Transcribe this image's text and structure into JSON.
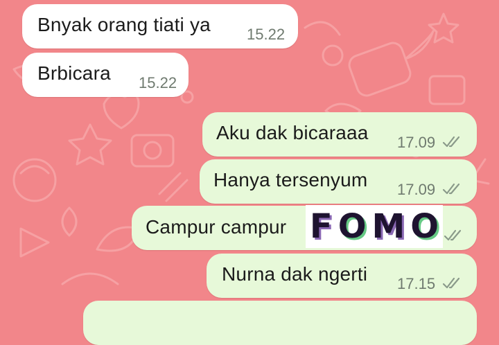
{
  "colors": {
    "wallpaper": "#f2868a",
    "incoming_bubble": "#ffffff",
    "outgoing_bubble": "#e7f9d9",
    "timestamp": "#6f7a6f",
    "ticks": "#8a9a8a"
  },
  "messages": [
    {
      "direction": "incoming",
      "text": "Bnyak orang tiati ya",
      "time": "15.22"
    },
    {
      "direction": "incoming",
      "text": "Brbicara",
      "time": "15.22"
    },
    {
      "direction": "outgoing",
      "text": "Aku dak bicaraaa",
      "time": "17.09",
      "status_icon": "double-check-icon"
    },
    {
      "direction": "outgoing",
      "text": "Hanya tersenyum",
      "time": "17.09",
      "status_icon": "double-check-icon"
    },
    {
      "direction": "outgoing",
      "text": "Campur campur",
      "sticker": {
        "letters": [
          "F",
          "O",
          "M",
          "O"
        ]
      },
      "status_icon": "double-check-icon"
    },
    {
      "direction": "outgoing",
      "text": "Nurna dak ngerti",
      "time": "17.15",
      "status_icon": "double-check-icon"
    }
  ]
}
